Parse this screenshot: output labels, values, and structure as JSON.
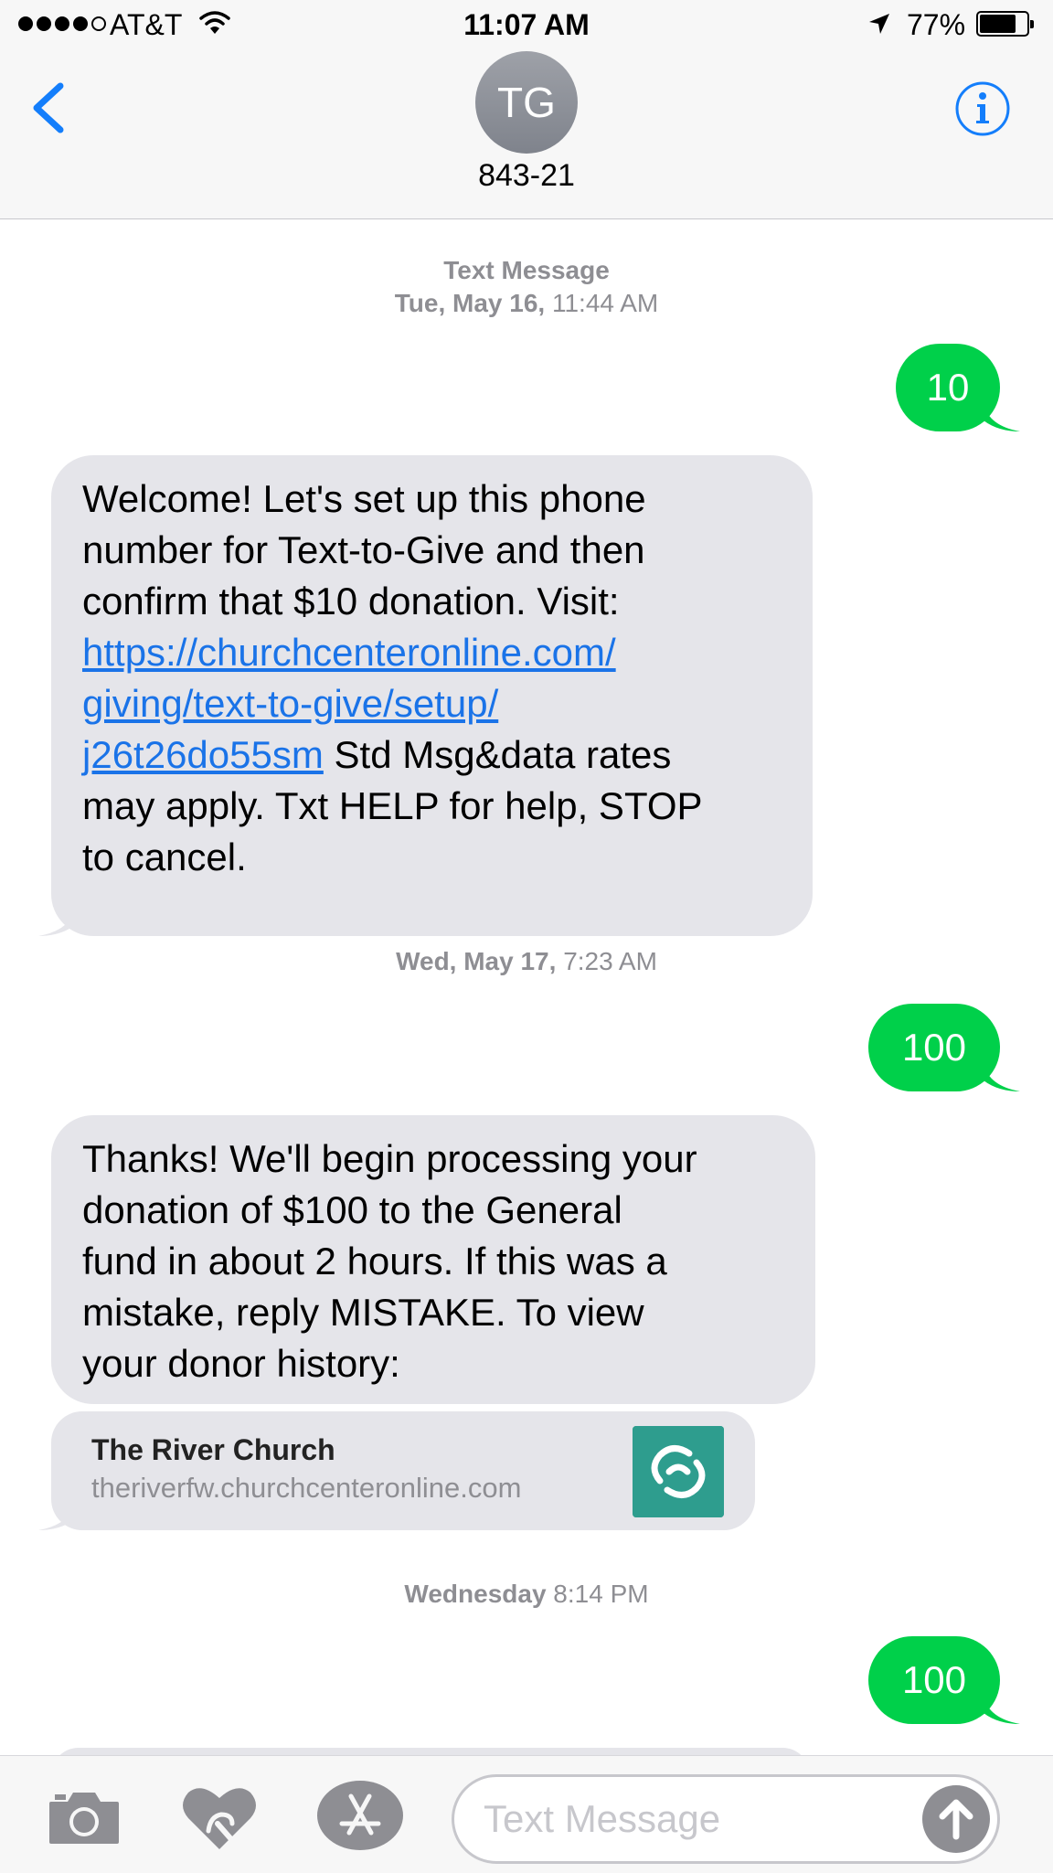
{
  "status_bar": {
    "carrier": "AT&T",
    "time": "11:07 AM",
    "battery_percent": "77%",
    "battery_level": 0.77,
    "signal_bars_filled": 4,
    "signal_bars_total": 5
  },
  "header": {
    "avatar_initials": "TG",
    "contact": "843-21"
  },
  "conversation": {
    "label_text_message": "Text Message",
    "stamp1_date": "Tue, May 16,",
    "stamp1_time": "11:44 AM",
    "msg_out_1": "10",
    "msg_in_1": {
      "text_a": "Welcome! Let's set up this phone",
      "text_b": "number for Text-to-Give and then",
      "text_c": "confirm that $10 donation. Visit:",
      "link_1": "https://churchcenteronline.com/",
      "link_2": "giving/text-to-give/setup/",
      "link_3": "j26t26do55sm",
      "text_d": " Std Msg&data rates",
      "text_e": "may apply. Txt HELP for help, STOP",
      "text_f": "to cancel."
    },
    "stamp2_date": "Wed, May 17,",
    "stamp2_time": "7:23 AM",
    "msg_out_2": "100",
    "msg_in_2": {
      "line_1": "Thanks! We'll begin processing your",
      "line_2": "donation of $100 to the General",
      "line_3": "fund in about 2 hours. If this was a",
      "line_4": "mistake, reply MISTAKE. To view",
      "line_5": "your donor history:"
    },
    "link_card": {
      "title": "The River Church",
      "url": "theriverfw.churchcenteronline.com"
    },
    "stamp3_day": "Wednesday",
    "stamp3_time": "8:14 PM",
    "msg_out_3": "100"
  },
  "input_bar": {
    "placeholder": "Text Message"
  },
  "colors": {
    "sent_bubble": "#00d04a",
    "received_bubble": "#e5e5ea",
    "ios_blue": "#147efb",
    "link_blue": "#1a73e8",
    "card_logo": "#2e9d8e"
  }
}
